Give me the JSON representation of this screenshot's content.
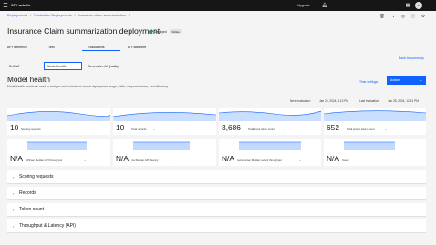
{
  "topbar": {
    "menu_icon": "menu-icon",
    "brand": "OFY website",
    "upgrade": "Upgrade",
    "notification_icon": "bell-icon",
    "avatar": "JT"
  },
  "breadcrumb": [
    "Deployments",
    "Production Deployments",
    "Insurance claim summarization"
  ],
  "breadcrumb_sep": "/",
  "page_title": "Insurance Claim summarization deployment",
  "status": {
    "label": "Deployed",
    "tag": "Online",
    "color": "#24a148"
  },
  "tabs": [
    "API reference",
    "Test",
    "Evaluations",
    "AI Factsheet"
  ],
  "back_link": "Back to summary",
  "subtabs": [
    "Drift v2",
    "Model health",
    "Generative AI Quality"
  ],
  "section": {
    "title": "Model health",
    "description": "Model health monitor is used to analyze and understand model deployment usage, traffic, responsiveness, and efficiency.",
    "time_settings": "Time settings",
    "actions": "Actions"
  },
  "evaluation": {
    "next_label": "Next evaluation:",
    "next_value": "Jan 25, 2024, 1:13 PM",
    "last_label": "Last evaluation:",
    "last_value": "Jan 25, 2024, 12:13 PM"
  },
  "metrics": [
    {
      "value": "10",
      "label": "Scoring requests"
    },
    {
      "value": "10",
      "label": "Total records"
    },
    {
      "value": "3,686",
      "label": "Total input token count"
    },
    {
      "value": "652",
      "label": "Total output token count"
    },
    {
      "value": "N/A",
      "label": "API/sec  Median API throughput"
    },
    {
      "value": "N/A",
      "label": "ms  Median API latency"
    },
    {
      "value": "N/A",
      "label": "records/sec  Median record throughput"
    },
    {
      "value": "N/A",
      "label": "Users"
    }
  ],
  "accordions": [
    "Scoring requests",
    "Records",
    "Token count",
    "Throughput & Latency (API)"
  ],
  "colors": {
    "accent": "#0f62fe",
    "chart_fill": "#a6c8ff",
    "chart_line": "#0f62fe"
  }
}
